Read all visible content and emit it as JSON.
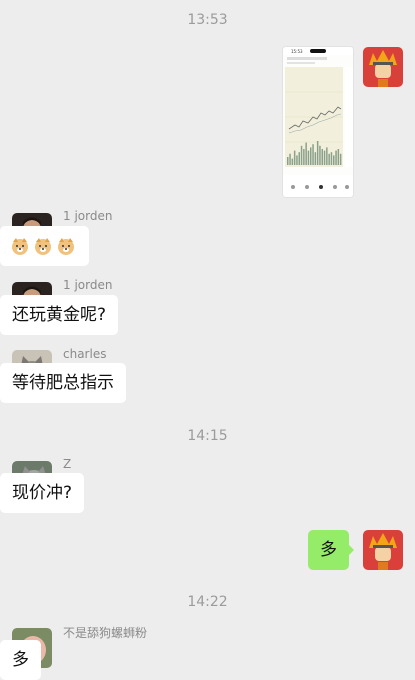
{
  "messages": {
    "t1": "13:53",
    "t2": "14:15",
    "t3": "14:22",
    "m1_sender": "1 jorden",
    "m2_sender": "1 jorden",
    "m2_text": "还玩黄金呢?",
    "m3_sender": "charles",
    "m3_text": "等待肥总指示",
    "m4_sender": "Z",
    "m4_text": "现价冲?",
    "m5_text": "多",
    "m6_sender": "不是舔狗螺蛳粉",
    "m6_text": "多"
  },
  "screenshot": {
    "status_time": "15:53",
    "values": [
      5,
      7,
      4,
      9,
      6,
      8,
      12,
      10,
      14,
      9,
      11,
      13,
      8,
      15,
      12,
      10,
      9,
      11,
      7,
      8,
      6,
      9,
      10,
      7
    ]
  },
  "colors": {
    "accent_green": "#95ec69",
    "background": "#ededed"
  }
}
